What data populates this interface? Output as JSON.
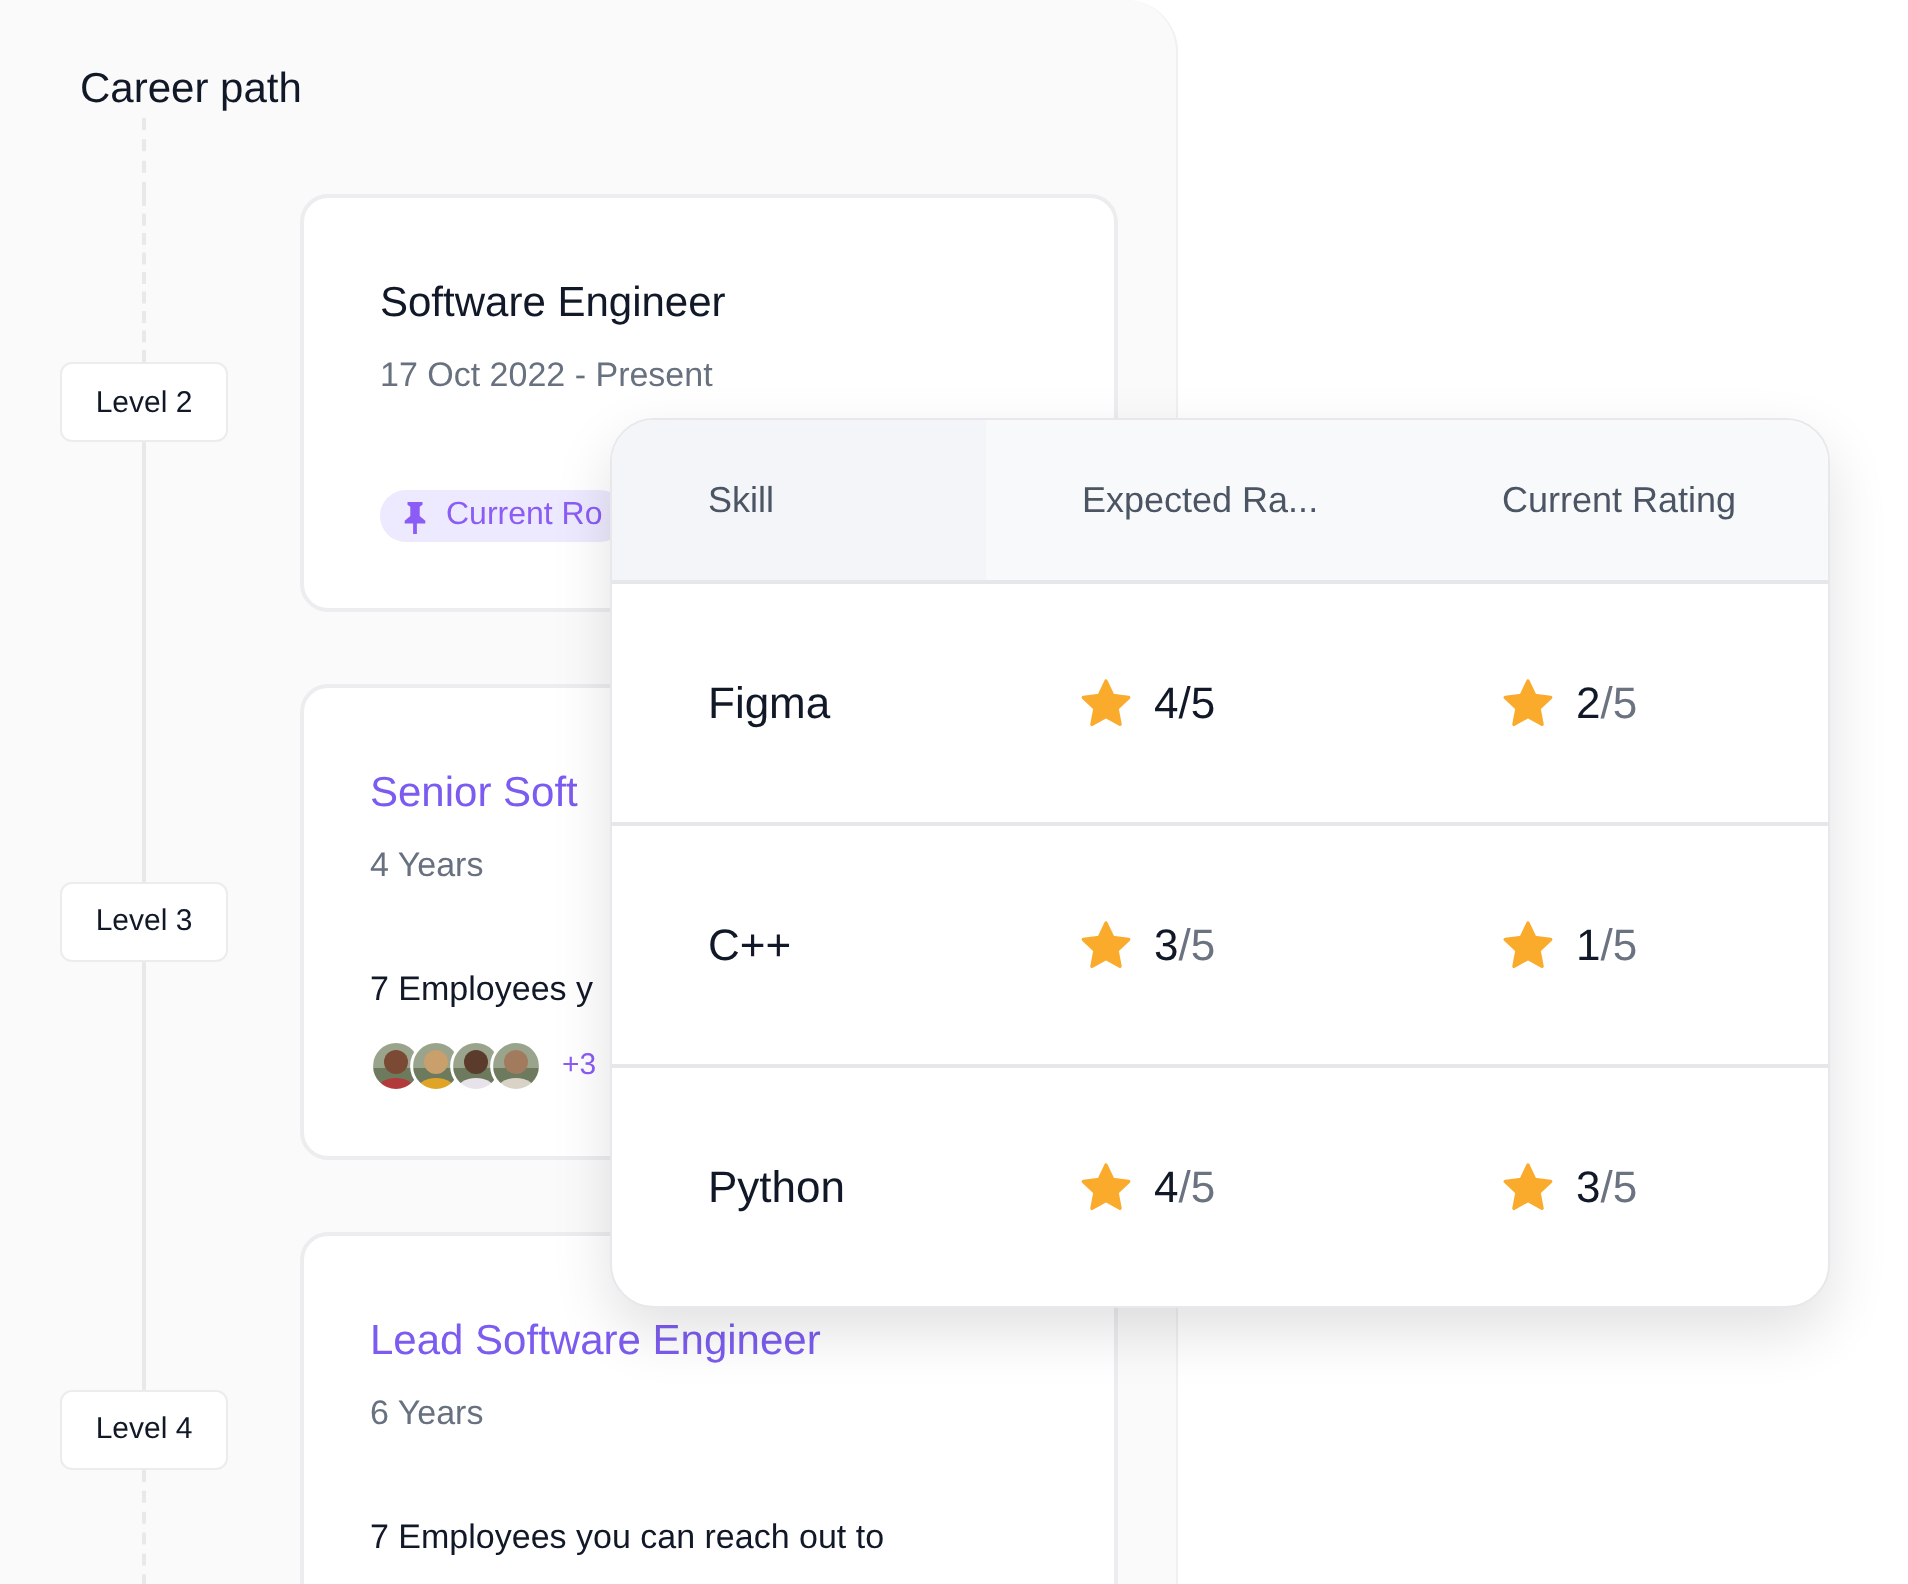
{
  "title": "Career path",
  "levels": [
    {
      "label": "Level 2",
      "title": "Software Engineer",
      "current": true,
      "subtitle": "17 Oct 2022 - Present",
      "badge": "Current Ro"
    },
    {
      "label": "Level 3",
      "title": "Senior Soft",
      "current": false,
      "subtitle": "4 Years",
      "employees": "7 Employees y",
      "more": "+3"
    },
    {
      "label": "Level 4",
      "title": "Lead Software Engineer",
      "current": false,
      "subtitle": "6 Years",
      "employees": "7 Employees you can reach out to"
    }
  ],
  "skills_table": {
    "columns": [
      "Skill",
      "Expected Ra...",
      "Current Rating"
    ],
    "rows": [
      {
        "skill": "Figma",
        "expected": {
          "value": "4",
          "out_of": "/5",
          "dimmed": false
        },
        "current": {
          "value": "2",
          "out_of": "/5",
          "dimmed": true
        }
      },
      {
        "skill": "C++",
        "expected": {
          "value": "3",
          "out_of": "/5",
          "dimmed": true
        },
        "current": {
          "value": "1",
          "out_of": "/5",
          "dimmed": true
        }
      },
      {
        "skill": "Python",
        "expected": {
          "value": "4",
          "out_of": "/5",
          "dimmed": true
        },
        "current": {
          "value": "3",
          "out_of": "/5",
          "dimmed": true
        }
      }
    ]
  }
}
